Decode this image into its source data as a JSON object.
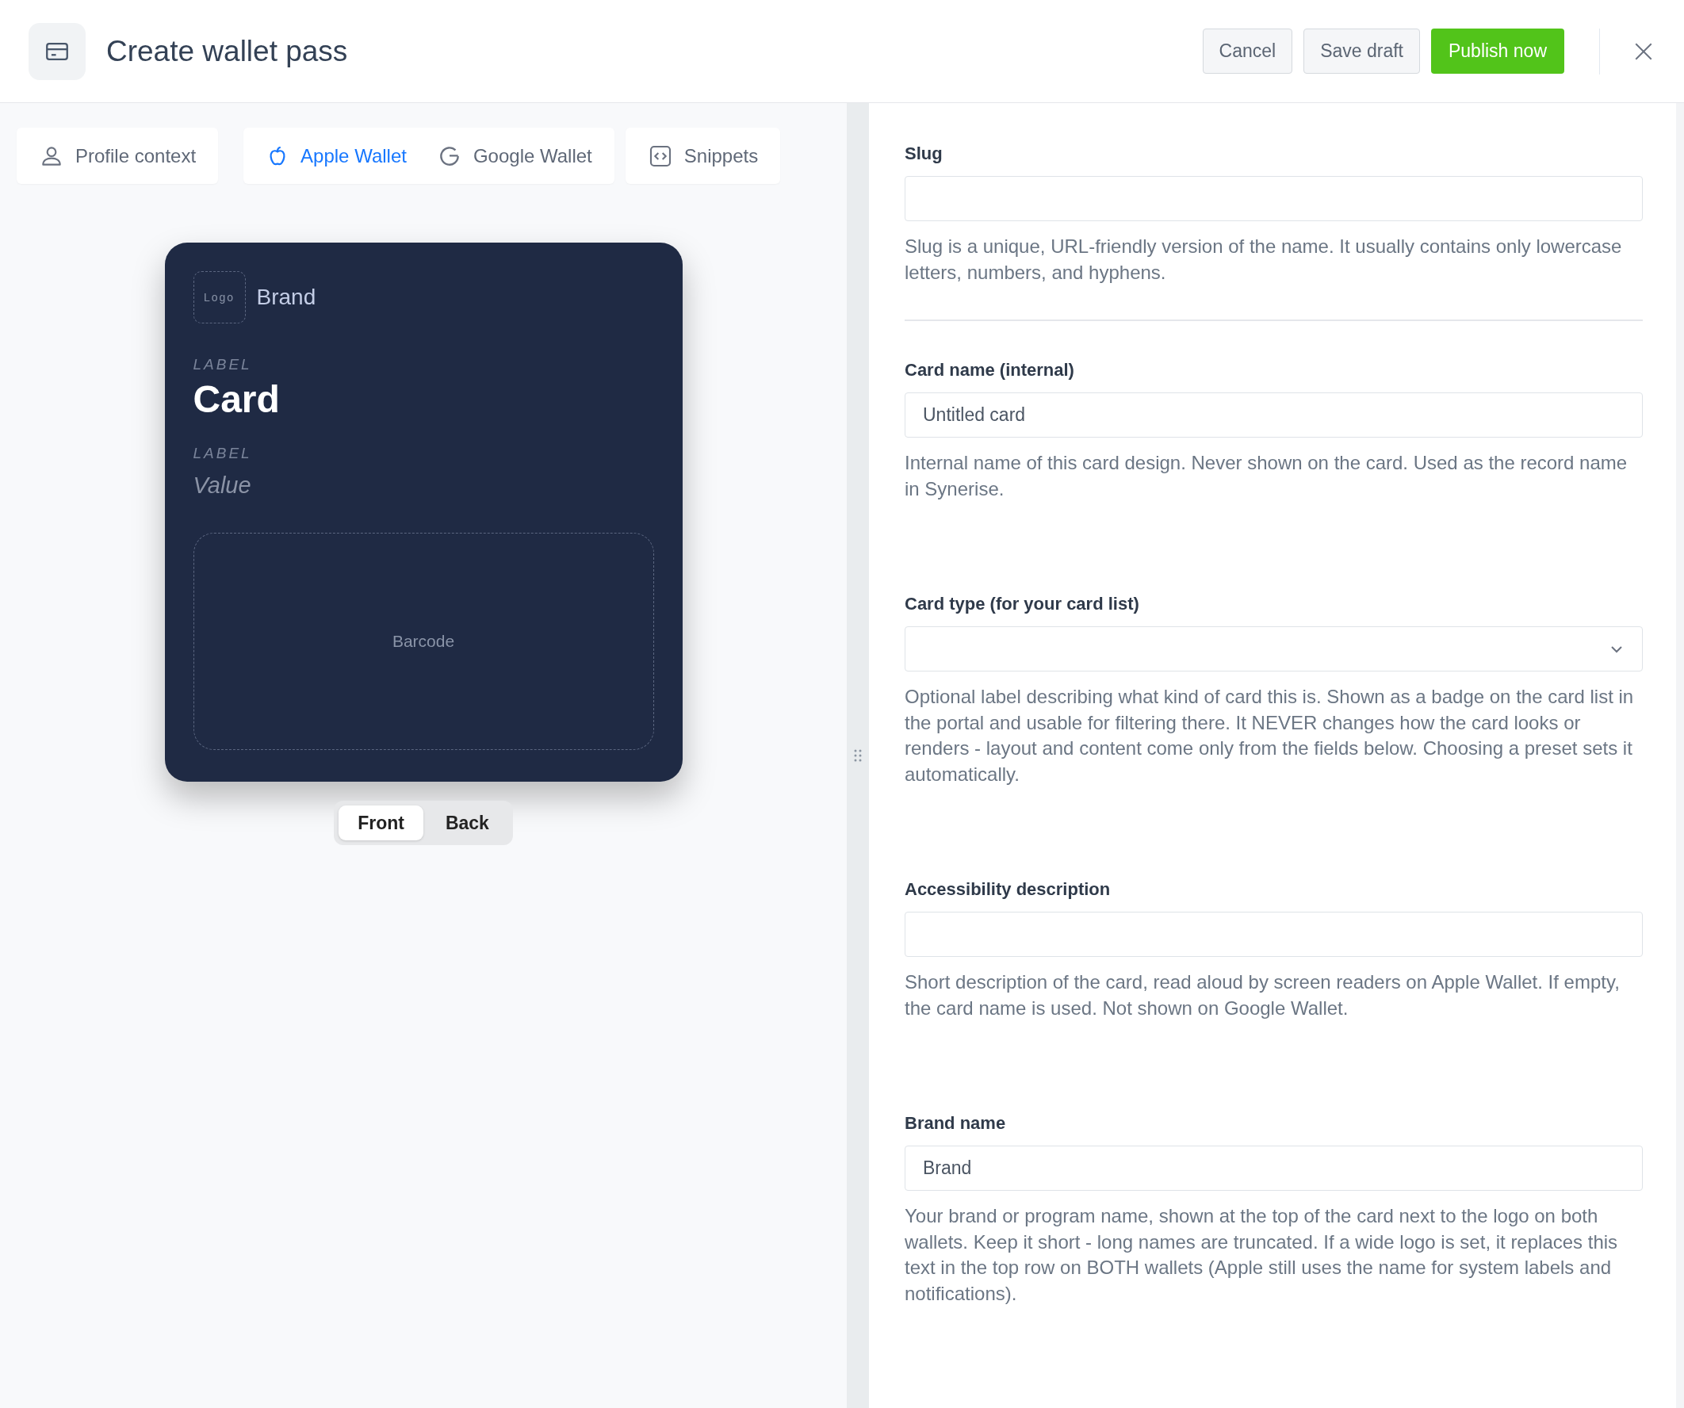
{
  "header": {
    "title": "Create wallet pass",
    "buttons": [
      {
        "label": "Cancel",
        "kind": "secondary"
      },
      {
        "label": "Save draft",
        "kind": "secondary"
      },
      {
        "label": "Publish now",
        "kind": "primary"
      }
    ]
  },
  "tab_groups": [
    {
      "tabs": [
        {
          "label": "Profile context",
          "selected": false
        }
      ]
    },
    {
      "tabs": [
        {
          "label": "Apple Wallet",
          "selected": true
        },
        {
          "label": "Google Wallet",
          "selected": false
        }
      ]
    },
    {
      "tabs": [
        {
          "label": "Snippets",
          "selected": false
        }
      ]
    }
  ],
  "card_preview": {
    "logo": "Logo",
    "brand": "Brand",
    "primary_label": "LABEL",
    "primary_value": "Card",
    "secondary_label": "LABEL",
    "secondary_value": "Value",
    "barcode": "Barcode"
  },
  "side_toggle": [
    {
      "label": "Front",
      "selected": true
    },
    {
      "label": "Back",
      "selected": false
    }
  ],
  "fields": [
    {
      "label": "Slug",
      "kind": "text",
      "help": "Slug is a unique, URL-friendly version of the name. It usually contains only lowercase letters, numbers, and hyphens.",
      "divider_after": true
    },
    {
      "label": "Card name (internal)",
      "kind": "text",
      "value": "Untitled card",
      "help": "Internal name of this card design. Never shown on the card. Used as the record name in Synerise."
    },
    {
      "label": "Card type (for your card list)",
      "kind": "select",
      "help": "Optional label describing what kind of card this is. Shown as a badge on the card list in the portal and usable for filtering there. It NEVER changes how the card looks or renders - layout and content come only from the fields below. Choosing a preset sets it automatically."
    },
    {
      "label": "Accessibility description",
      "kind": "text",
      "help": "Short description of the card, read aloud by screen readers on Apple Wallet. If empty, the card name is used. Not shown on Google Wallet."
    },
    {
      "label": "Brand name",
      "kind": "text",
      "value": "Brand",
      "help": "Your brand or program name, shown at the top of the card next to the logo on both wallets. Keep it short - long names are truncated. If a wide logo is set, it replaces this text in the top row on BOTH wallets (Apple still uses the name for system labels and notifications)."
    }
  ]
}
